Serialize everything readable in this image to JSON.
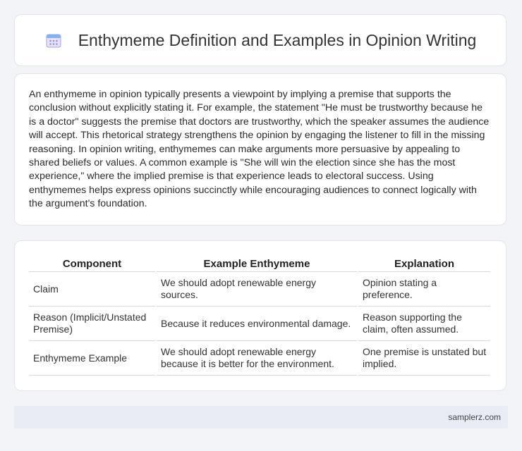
{
  "header": {
    "title": "Enthymeme Definition and Examples in Opinion Writing",
    "icon": "calendar-icon"
  },
  "intro": {
    "text": "An enthymeme in opinion typically presents a viewpoint by implying a premise that supports the conclusion without explicitly stating it. For example, the statement \"He must be trustworthy because he is a doctor\" suggests the premise that doctors are trustworthy, which the speaker assumes the audience will accept. This rhetorical strategy strengthens the opinion by engaging the listener to fill in the missing reasoning. In opinion writing, enthymemes can make arguments more persuasive by appealing to shared beliefs or values. A common example is \"She will win the election since she has the most experience,\" where the implied premise is that experience leads to electoral success. Using enthymemes helps express opinions succinctly while encouraging audiences to connect logically with the argument's foundation."
  },
  "table": {
    "headers": [
      "Component",
      "Example Enthymeme",
      "Explanation"
    ],
    "rows": [
      [
        "Claim",
        "We should adopt renewable energy sources.",
        "Opinion stating a preference."
      ],
      [
        "Reason (Implicit/Unstated Premise)",
        "Because it reduces environmental damage.",
        "Reason supporting the claim, often assumed."
      ],
      [
        "Enthymeme Example",
        "We should adopt renewable energy because it is better for the environment.",
        "One premise is unstated but implied."
      ]
    ]
  },
  "footer": {
    "site": "samplerz.com"
  },
  "colors": {
    "background": "#f3f4f8",
    "footer_bg": "#e9ecf5",
    "icon_accent": "#8a7fd8"
  }
}
